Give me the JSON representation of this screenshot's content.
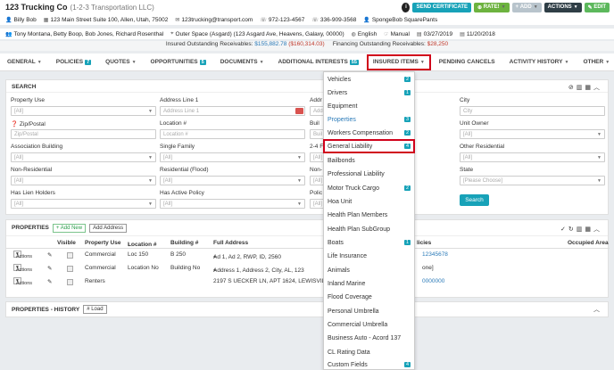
{
  "header": {
    "title": "123 Trucking Co",
    "subtitle": "(1-2-3 Transportation LLC)",
    "info_icon": "i",
    "buttons": {
      "certificate": "SEND CERTIFICATE",
      "rate": "RATE!",
      "add": "ADD",
      "actions": "ACTIONS",
      "edit": "EDIT"
    }
  },
  "info_row1": {
    "contact": "Billy Bob",
    "address": "123 Main Street Suite 100, Allen, Utah, 75002",
    "email": "123trucking@transport.com",
    "phone1": "972-123-4567",
    "phone2": "336-909-3568",
    "company": "SpongeBob SquarePants"
  },
  "info_row2": {
    "people": "Tony Montana, Betty Boop, Bob Jones, Richard Rosenthal",
    "location": "Outer Space (Asgard) (123 Asgard Ave, Heavens, Galaxy, 00000)",
    "language": "English",
    "mode": "Manual",
    "date1": "03/27/2019",
    "date2": "11/20/2018"
  },
  "receivables": {
    "insured_label": "Insured Outstanding Receivables:",
    "insured_value": "$155,882.78",
    "insured_neg": "($160,314.03)",
    "financing_label": "Financing Outstanding Receivables:",
    "financing_value": "$28,250"
  },
  "tabs": {
    "general": "GENERAL",
    "policies": "POLICIES",
    "policies_count": "7",
    "quotes": "QUOTES",
    "opportunities": "OPPORTUNITIES",
    "opportunities_count": "5",
    "documents": "DOCUMENTS",
    "additional": "ADDITIONAL INTERESTS",
    "additional_count": "55",
    "insured_items": "INSURED ITEMS",
    "pending": "PENDING CANCELS",
    "activity": "ACTIVITY HISTORY",
    "other": "OTHER"
  },
  "search": {
    "title": "SEARCH",
    "search_button": "Search",
    "fields": {
      "property_use": {
        "label": "Property Use",
        "value": "[All]"
      },
      "address1": {
        "label": "Address Line 1",
        "placeholder": "Address Line 1"
      },
      "address_trunc": {
        "label": "Addr",
        "placeholder": "Add"
      },
      "city": {
        "label": "City",
        "placeholder": "City"
      },
      "zip": {
        "label": "Zip/Postal",
        "placeholder": "Zip/Postal"
      },
      "location": {
        "label": "Location #",
        "placeholder": "Location #"
      },
      "building_trunc": {
        "label": "Buil",
        "placeholder": "Buil"
      },
      "unit_owner": {
        "label": "Unit Owner",
        "value": "[All]"
      },
      "association": {
        "label": "Association Building",
        "value": "[All]"
      },
      "single_family": {
        "label": "Single Family",
        "value": "[All]"
      },
      "two_four": {
        "label": "2-4 F",
        "value": "[All]"
      },
      "other_res": {
        "label": "Other Residential",
        "value": "[All]"
      },
      "non_res": {
        "label": "Non-Residential",
        "value": "[All]"
      },
      "res_flood": {
        "label": "Residential (Flood)",
        "value": "[All]"
      },
      "non_trunc": {
        "label": "Non-",
        "value": "[All]"
      },
      "state": {
        "label": "State",
        "value": "[Please Choose]"
      },
      "lien": {
        "label": "Has Lien Holders",
        "value": "[All]"
      },
      "active_policy": {
        "label": "Has Active Policy",
        "value": "[All]"
      },
      "policy_trunc": {
        "label": "Polic",
        "value": "[All]"
      }
    }
  },
  "properties": {
    "title": "PROPERTIES",
    "add_new": "+ Add New",
    "add_address": "Add Address",
    "columns": {
      "visible": "Visible",
      "property_use": "Property Use",
      "location": "Location #",
      "building": "Building #",
      "full_address": "Full Address",
      "policies": "licies",
      "occupied": "Occupied Area"
    },
    "rows": [
      {
        "actions": "Actions",
        "use": "Commercial",
        "location": "Loc 150",
        "building": "B 250",
        "address": "Ad 1, Ad 2, RWP, ID, 2560",
        "policy": "12345678"
      },
      {
        "actions": "Actions",
        "use": "Commercial",
        "location": "Location No",
        "building": "Building No",
        "address": "Address 1, Address 2, City, AL, 123",
        "policy": "one]"
      },
      {
        "actions": "Actions",
        "use": "Renters",
        "location": "",
        "building": "",
        "address": "2197 S UECKER LN, APT 1624, LEWISVILLE,",
        "policy": "0000000"
      }
    ]
  },
  "history": {
    "title": "PROPERTIES - HISTORY",
    "load": "# Load"
  },
  "menu": {
    "vehicles": {
      "label": "Vehicles",
      "count": "2"
    },
    "drivers": {
      "label": "Drivers",
      "count": "1"
    },
    "equipment": {
      "label": "Equipment"
    },
    "properties": {
      "label": "Properties",
      "count": "3"
    },
    "workers_comp": {
      "label": "Workers Compensation",
      "count": "2"
    },
    "general_liability": {
      "label": "General Liability",
      "count": "4"
    },
    "bailbonds": {
      "label": "Bailbonds"
    },
    "professional_liability": {
      "label": "Professional Liability"
    },
    "motor_truck_cargo": {
      "label": "Motor Truck Cargo",
      "count": "2"
    },
    "hoa_unit": {
      "label": "Hoa Unit"
    },
    "health_plan_members": {
      "label": "Health Plan Members"
    },
    "health_plan_subgroup": {
      "label": "Health Plan SubGroup"
    },
    "boats": {
      "label": "Boats",
      "count": "1"
    },
    "life_insurance": {
      "label": "Life Insurance"
    },
    "animals": {
      "label": "Animals"
    },
    "inland_marine": {
      "label": "Inland Marine"
    },
    "flood_coverage": {
      "label": "Flood Coverage"
    },
    "personal_umbrella": {
      "label": "Personal Umbrella"
    },
    "commercial_umbrella": {
      "label": "Commercial Umbrella"
    },
    "business_auto": {
      "label": "Business Auto - Acord 137"
    },
    "cl_rating_data": {
      "label": "CL Rating Data"
    },
    "custom_fields": {
      "label": "Custom Fields",
      "count": "4"
    }
  }
}
